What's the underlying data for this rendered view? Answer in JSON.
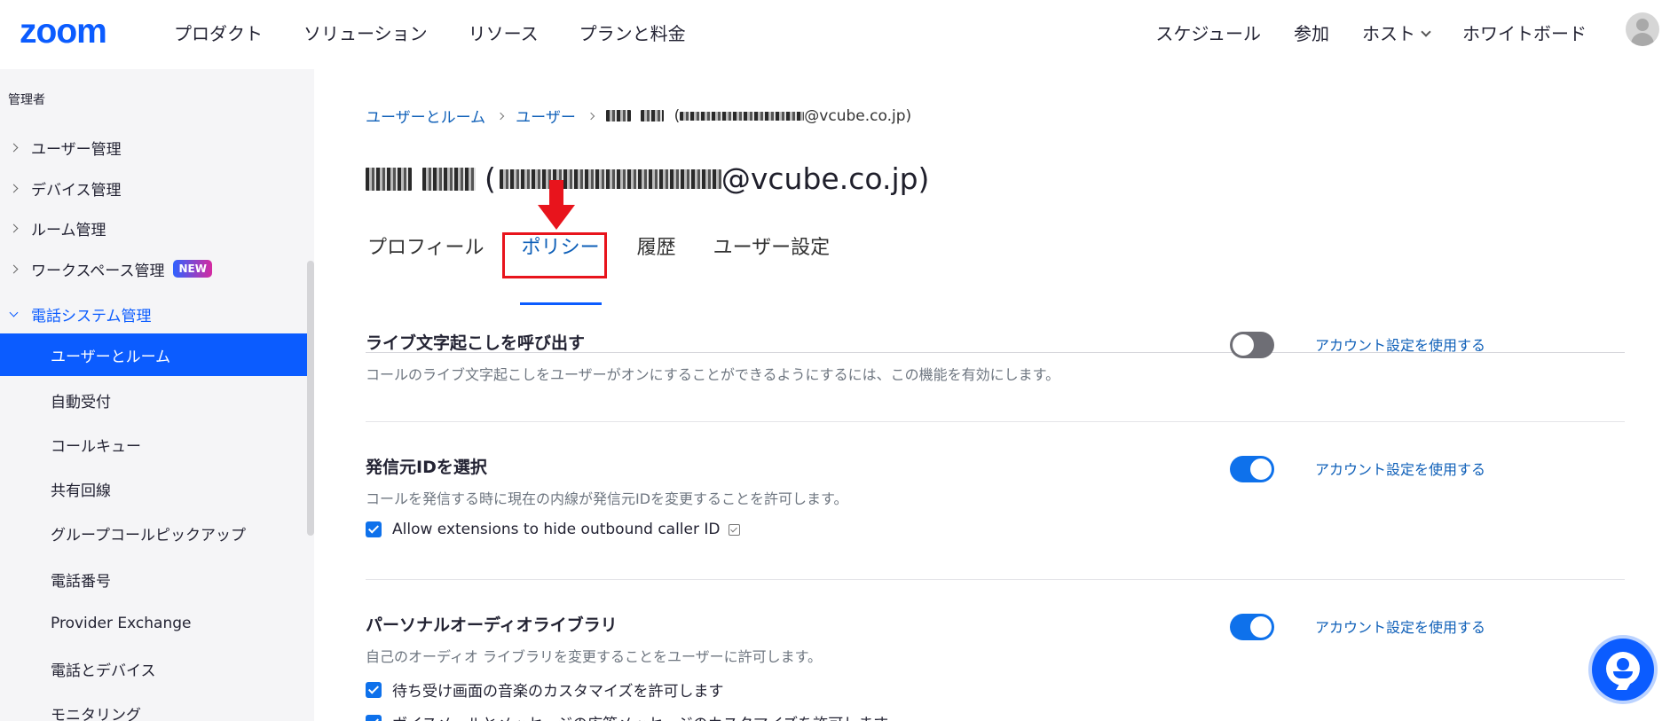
{
  "topbar": {
    "logo": "zoom",
    "nav_left": [
      "プロダクト",
      "ソリューション",
      "リソース",
      "プランと料金"
    ],
    "nav_right": {
      "schedule": "スケジュール",
      "join": "参加",
      "host": "ホスト",
      "whiteboard": "ホワイトボード"
    }
  },
  "sidebar": {
    "section": "管理者",
    "items": [
      {
        "label": "ユーザー管理"
      },
      {
        "label": "デバイス管理"
      },
      {
        "label": "ルーム管理"
      },
      {
        "label": "ワークスペース管理",
        "badge": "NEW"
      },
      {
        "label": "電話システム管理"
      }
    ],
    "subitems": [
      "ユーザーとルーム",
      "自動受付",
      "コールキュー",
      "共有回線",
      "グループコールピックアップ",
      "電話番号",
      "Provider Exchange",
      "電話とデバイス",
      "モニタリング"
    ]
  },
  "breadcrumb": {
    "items": [
      "ユーザーとルーム",
      "ユーザー"
    ],
    "current_suffix": "@vcube.co.jp)",
    "current_open": "("
  },
  "page_title": {
    "open": "(",
    "suffix": "@vcube.co.jp)"
  },
  "tabs": [
    "プロフィール",
    "ポリシー",
    "履歴",
    "ユーザー設定"
  ],
  "settings": [
    {
      "title": "ライブ文字起こしを呼び出す",
      "desc": "コールのライブ文字起こしをユーザーがオンにすることができるようにするには、この機能を有効にします。",
      "enabled": false,
      "link": "アカウント設定を使用する"
    },
    {
      "title": "発信元IDを選択",
      "desc": "コールを発信する時に現在の内線が発信元IDを変更することを許可します。",
      "enabled": true,
      "link": "アカウント設定を使用する",
      "checks": [
        "Allow extensions to hide outbound caller ID"
      ]
    },
    {
      "title": "パーソナルオーディオライブラリ",
      "desc": "自己のオーディオ ライブラリを変更することをユーザーに許可します。",
      "enabled": true,
      "link": "アカウント設定を使用する",
      "checks": [
        "待ち受け画面の音楽のカスタマイズを許可します",
        "ボイスメールとメッセージの応答メッセージのカスタマイズを許可します"
      ]
    }
  ],
  "colors": {
    "brand": "#0b5cff",
    "link": "#0e5fb8",
    "highlight": "#e8141c",
    "toggle_off": "#6e6e75"
  },
  "icons": {
    "chat": "chat-bot-icon",
    "avatar": "user-avatar-icon",
    "arrow": "red-down-arrow-icon"
  }
}
